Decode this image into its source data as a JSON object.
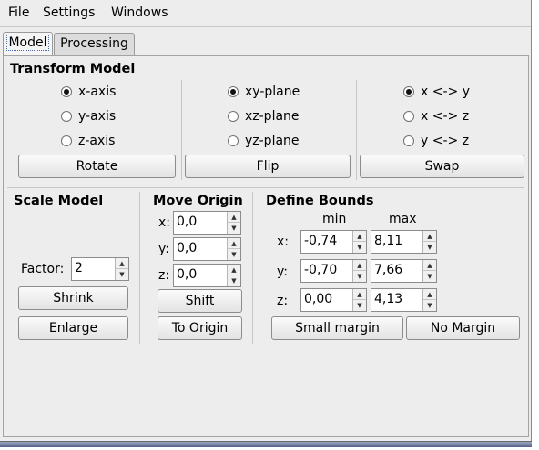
{
  "menubar": {
    "items": [
      "File",
      "Settings",
      "Windows"
    ]
  },
  "tabs": [
    {
      "label": "Model",
      "active": true
    },
    {
      "label": "Processing",
      "active": false
    }
  ],
  "transform": {
    "title": "Transform Model",
    "axes": [
      {
        "label": "x-axis",
        "checked": true
      },
      {
        "label": "y-axis",
        "checked": false
      },
      {
        "label": "z-axis",
        "checked": false
      }
    ],
    "rotate_label": "Rotate",
    "planes": [
      {
        "label": "xy-plane",
        "checked": true
      },
      {
        "label": "xz-plane",
        "checked": false
      },
      {
        "label": "yz-plane",
        "checked": false
      }
    ],
    "flip_label": "Flip",
    "swaps": [
      {
        "label": "x <-> y",
        "checked": true
      },
      {
        "label": "x <-> z",
        "checked": false
      },
      {
        "label": "y <-> z",
        "checked": false
      }
    ],
    "swap_label": "Swap"
  },
  "scale": {
    "title": "Scale Model",
    "factor_label": "Factor:",
    "factor_value": "2",
    "shrink_label": "Shrink",
    "enlarge_label": "Enlarge"
  },
  "origin": {
    "title": "Move Origin",
    "x_label": "x:",
    "x_value": "0,0",
    "y_label": "y:",
    "y_value": "0,0",
    "z_label": "z:",
    "z_value": "0,0",
    "shift_label": "Shift",
    "to_origin_label": "To Origin"
  },
  "bounds": {
    "title": "Define Bounds",
    "min_header": "min",
    "max_header": "max",
    "x_label": "x:",
    "x_min": "-0,74",
    "x_max": "8,11",
    "y_label": "y:",
    "y_min": "-0,70",
    "y_max": "7,66",
    "z_label": "z:",
    "z_min": "0,00",
    "z_max": "4,13",
    "small_margin_label": "Small margin",
    "no_margin_label": "No Margin"
  }
}
